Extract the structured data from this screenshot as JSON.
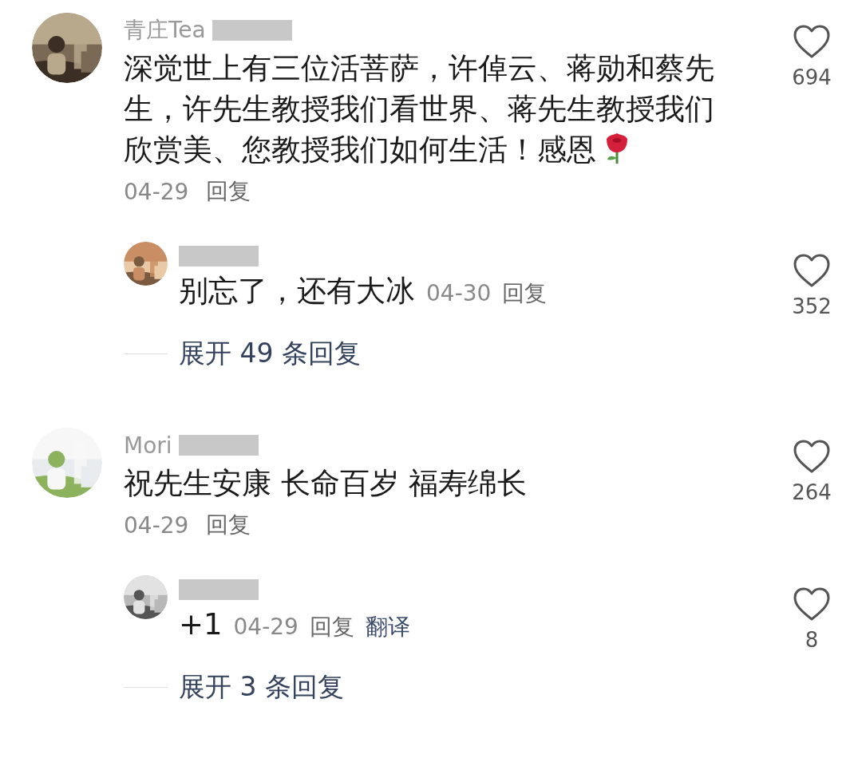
{
  "comments": [
    {
      "name": "青庄Tea",
      "text": "深觉世上有三位活菩萨，许倬云、蒋勋和蔡先生，许先生教授我们看世界、蒋先生教授我们欣赏美、您教授我们如何生活！感恩",
      "rose_icon": true,
      "date": "04-29",
      "reply_label": "回复",
      "likes": "694",
      "replies": [
        {
          "text": "别忘了，还有大冰",
          "date": "04-30",
          "reply_label": "回复",
          "likes": "352"
        }
      ],
      "expand": "展开 49 条回复"
    },
    {
      "name": "Mori",
      "text": "祝先生安康 长命百岁 福寿绵长",
      "rose_icon": false,
      "date": "04-29",
      "reply_label": "回复",
      "likes": "264",
      "replies": [
        {
          "text": "+1",
          "date": "04-29",
          "reply_label": "回复",
          "translate": "翻译",
          "likes": "8"
        }
      ],
      "expand": "展开 3 条回复"
    }
  ]
}
